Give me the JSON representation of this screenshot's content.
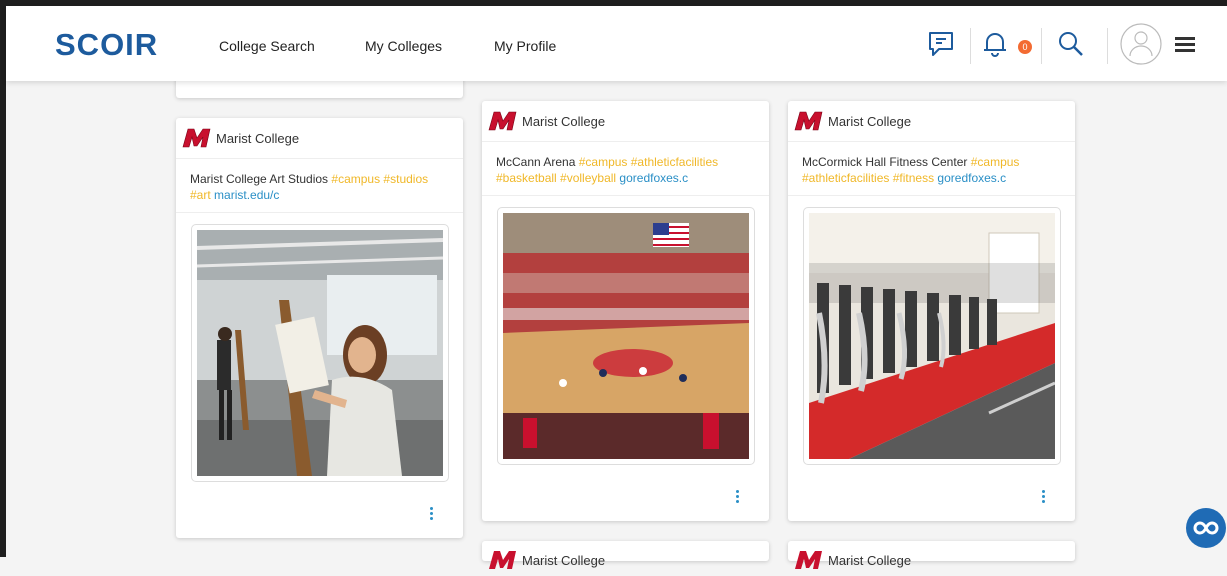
{
  "header": {
    "logo": "SCOIR",
    "nav": [
      "College Search",
      "My Colleges",
      "My Profile"
    ],
    "notification_count": "0",
    "icons": [
      "message-icon",
      "bell-icon",
      "search-icon",
      "avatar-icon",
      "hamburger-menu-icon"
    ]
  },
  "cards": [
    {
      "college": "Marist College",
      "title": "Marist College Art Studios",
      "tags": "#campus #studios",
      "tags2": "#art",
      "link": "marist.edu/c",
      "photo": "art studio with painters at easels"
    },
    {
      "college": "Marist College",
      "title": "McCann Arena",
      "tags": "#campus #athleticfacilities",
      "tags2": "#basketball #volleyball",
      "link": "goredfoxes.c",
      "photo": "basketball game in arena"
    },
    {
      "college": "Marist College",
      "title": "McCormick Hall Fitness Center",
      "tags": "#campus",
      "tags2": "#athleticfacilities #fitness",
      "link": "goredfoxes.c",
      "photo": "fitness center with elliptical machines"
    }
  ],
  "partial_cards": [
    "Marist College",
    "Marist College"
  ],
  "colors": {
    "brand": "#1d5b9d",
    "tag": "#f0b829",
    "link": "#2a8fc6",
    "badge": "#f36b32",
    "marist_red": "#c8102e"
  }
}
